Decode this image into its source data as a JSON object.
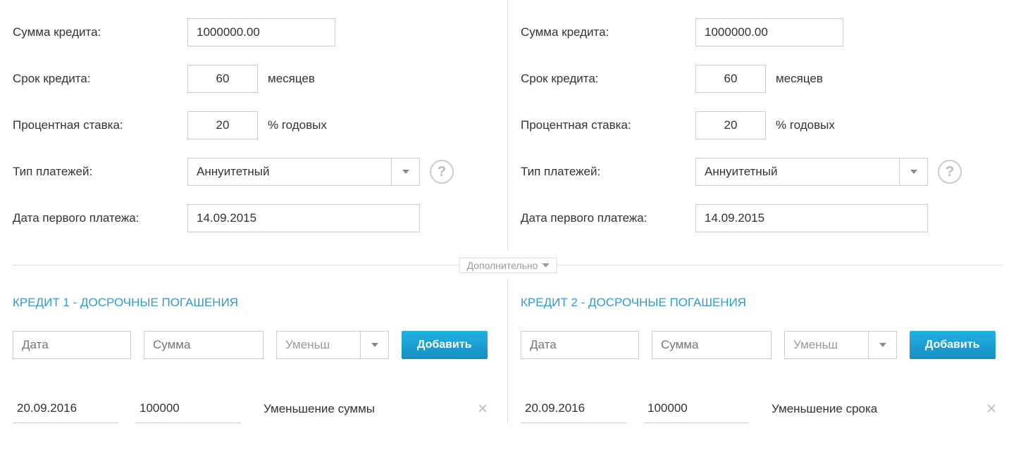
{
  "labels": {
    "amount": "Сумма кредита:",
    "term": "Срок кредита:",
    "term_unit": "месяцев",
    "rate": "Процентная ставка:",
    "rate_unit": "% годовых",
    "payment_type": "Тип платежей:",
    "first_payment_date": "Дата первого платежа:",
    "additional": "Дополнительно",
    "add_date_placeholder": "Дата",
    "add_amount_placeholder": "Сумма",
    "add_type_placeholder": "Уменьш",
    "add_button": "Добавить",
    "help": "?"
  },
  "credit1": {
    "amount": "1000000.00",
    "term": "60",
    "rate": "20",
    "payment_type": "Аннуитетный",
    "first_payment_date": "14.09.2015",
    "section_title": "КРЕДИТ 1 - ДОСРОЧНЫЕ ПОГАШЕНИЯ",
    "entry": {
      "date": "20.09.2016",
      "amount": "100000",
      "type": "Уменьшение суммы"
    }
  },
  "credit2": {
    "amount": "1000000.00",
    "term": "60",
    "rate": "20",
    "payment_type": "Аннуитетный",
    "first_payment_date": "14.09.2015",
    "section_title": "КРЕДИТ 2 - ДОСРОЧНЫЕ ПОГАШЕНИЯ",
    "entry": {
      "date": "20.09.2016",
      "amount": "100000",
      "type": "Уменьшение срока"
    }
  }
}
